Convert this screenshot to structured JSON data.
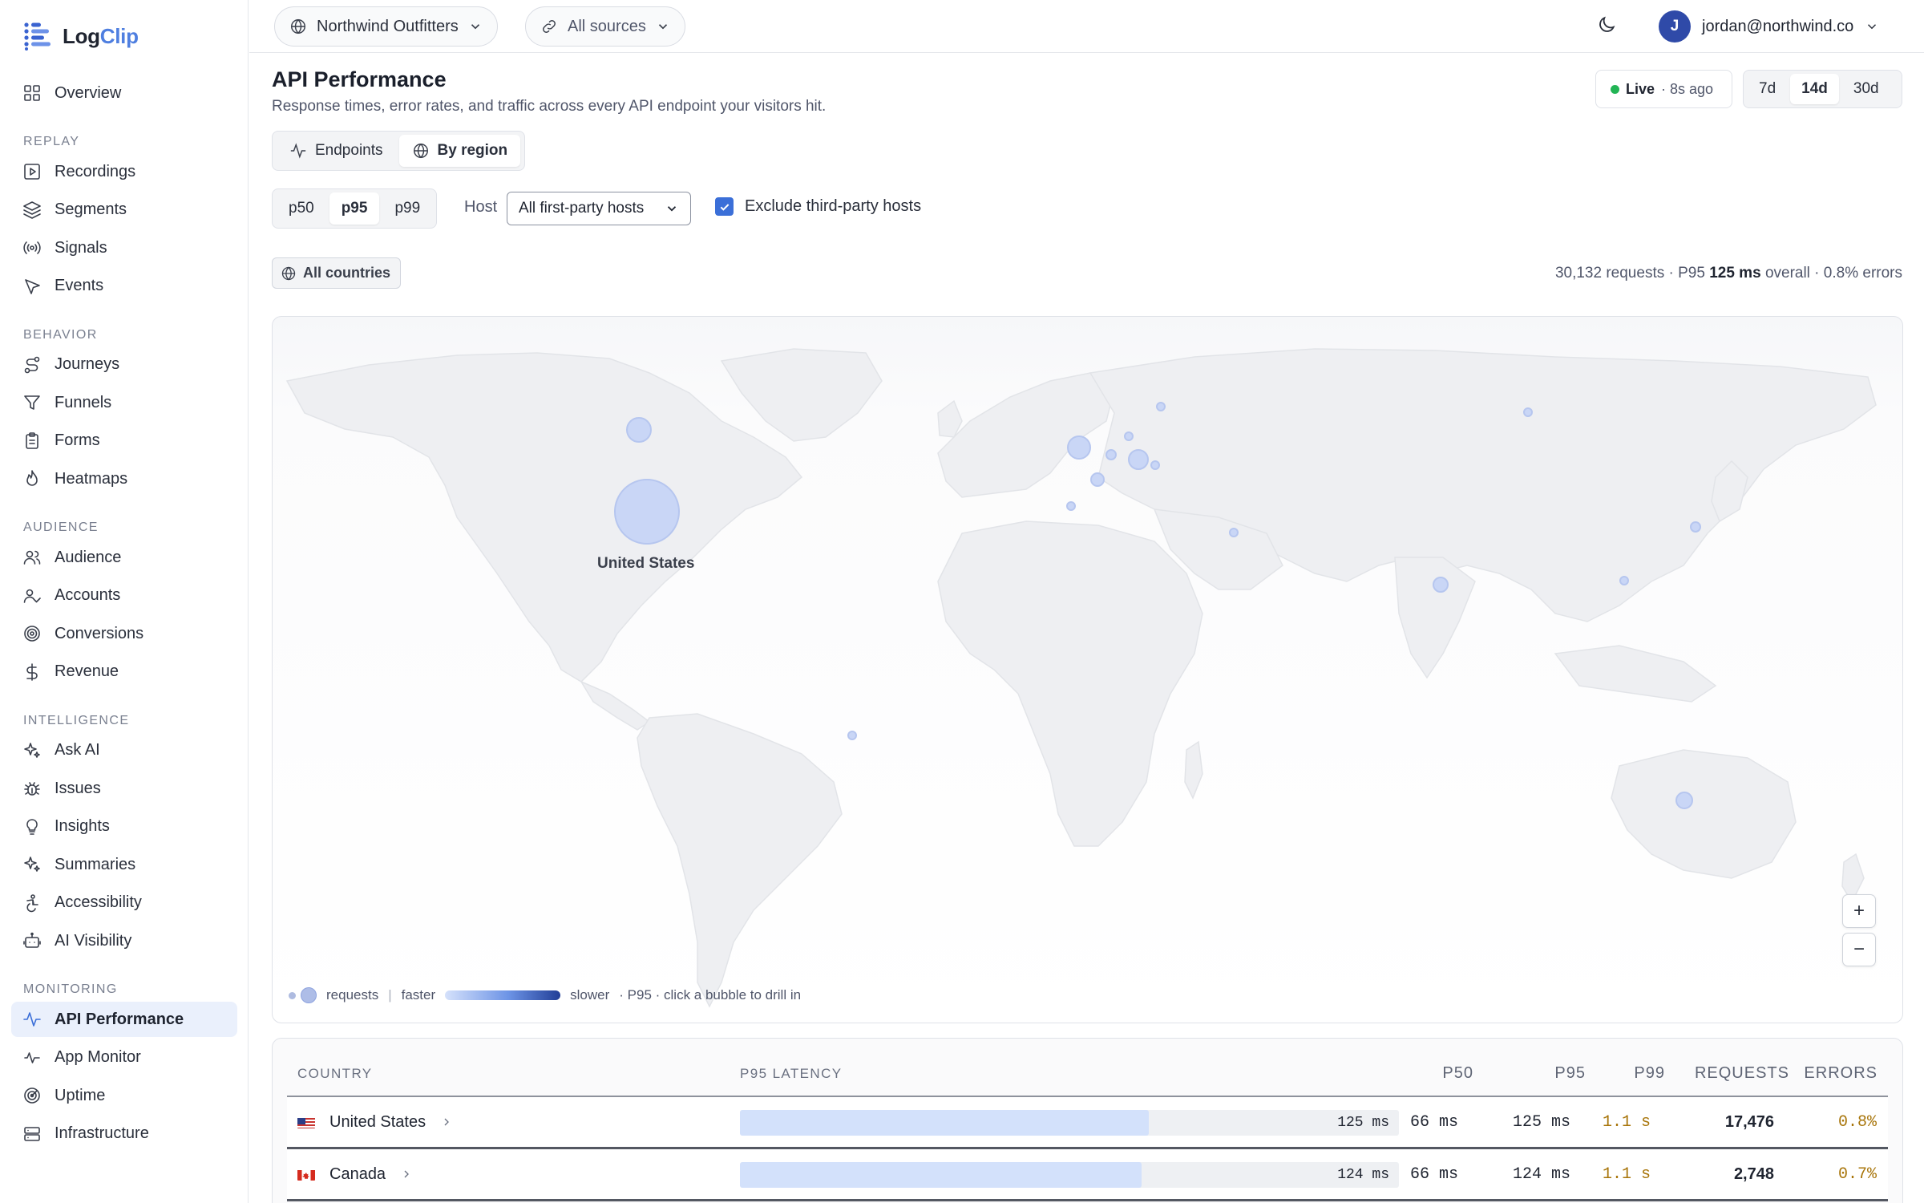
{
  "app": {
    "brand_part1": "Log",
    "brand_part2": "Clip",
    "accent": "#3b6fd8"
  },
  "sidebar": {
    "top_item": {
      "label": "Overview",
      "icon": "grid-icon"
    },
    "sections": [
      {
        "label": "Replay",
        "items": [
          {
            "label": "Recordings",
            "icon": "play-square-icon"
          },
          {
            "label": "Segments",
            "icon": "layers-icon"
          },
          {
            "label": "Signals",
            "icon": "broadcast-icon"
          },
          {
            "label": "Events",
            "icon": "cursor-icon"
          }
        ]
      },
      {
        "label": "Behavior",
        "items": [
          {
            "label": "Journeys",
            "icon": "route-icon"
          },
          {
            "label": "Funnels",
            "icon": "funnel-icon"
          },
          {
            "label": "Forms",
            "icon": "clipboard-icon"
          },
          {
            "label": "Heatmaps",
            "icon": "flame-icon"
          }
        ]
      },
      {
        "label": "Audience",
        "items": [
          {
            "label": "Audience",
            "icon": "users-icon"
          },
          {
            "label": "Accounts",
            "icon": "user-check-icon"
          },
          {
            "label": "Conversions",
            "icon": "target-icon"
          },
          {
            "label": "Revenue",
            "icon": "dollar-icon"
          }
        ]
      },
      {
        "label": "Intelligence",
        "items": [
          {
            "label": "Ask AI",
            "icon": "sparkles-icon"
          },
          {
            "label": "Issues",
            "icon": "bug-icon"
          },
          {
            "label": "Insights",
            "icon": "lightbulb-icon"
          },
          {
            "label": "Summaries",
            "icon": "sparkles-icon"
          },
          {
            "label": "Accessibility",
            "icon": "accessibility-icon"
          },
          {
            "label": "AI Visibility",
            "icon": "bot-icon"
          }
        ]
      },
      {
        "label": "Monitoring",
        "items": [
          {
            "label": "API Performance",
            "icon": "activity-icon",
            "active": true
          },
          {
            "label": "App Monitor",
            "icon": "monitor-icon"
          },
          {
            "label": "Uptime",
            "icon": "radar-icon"
          },
          {
            "label": "Infrastructure",
            "icon": "server-icon"
          }
        ]
      }
    ]
  },
  "topbar": {
    "workspace": "Northwind Outfitters",
    "sources": "All sources",
    "user_initial": "J",
    "user_email": "jordan@northwind.co"
  },
  "header": {
    "title": "API Performance",
    "subtitle": "Response times, error rates, and traffic across every API endpoint your visitors hit.",
    "live_label": "Live",
    "live_age": "· 8s ago",
    "ranges": [
      "7d",
      "14d",
      "30d"
    ],
    "range_selected": "14d"
  },
  "view_tabs": [
    {
      "label": "Endpoints",
      "icon": "activity-icon"
    },
    {
      "label": "By region",
      "icon": "globe-icon",
      "selected": true
    }
  ],
  "filters": {
    "percentiles": [
      "p50",
      "p95",
      "p99"
    ],
    "percentile_selected": "p95",
    "host_label": "Host",
    "host_value": "All first-party hosts",
    "exclude_label": "Exclude third-party hosts",
    "exclude_checked": true,
    "country_chip": "All countries"
  },
  "summary": {
    "requests": "30,132 requests · P95",
    "overall_value": "125 ms",
    "overall_suffix": "overall · 0.8% errors"
  },
  "map": {
    "highlight_label": "United States",
    "zoom_in": "+",
    "zoom_out": "−",
    "legend": {
      "requests": "requests",
      "sep": "|",
      "faster": "faster",
      "slower": "slower",
      "note": "· P95 · click a bubble to drill in"
    },
    "bubble_color": "#c9d6f6",
    "bubble_stroke": "#b6c6ef"
  },
  "table": {
    "headers": {
      "country": "Country",
      "latency": "P95 Latency",
      "p50": "P50",
      "p95": "P95",
      "p99": "P99",
      "requests": "Requests",
      "errors": "Errors"
    },
    "rows": [
      {
        "country": "United States",
        "flag": "us-flag-icon",
        "latency": "125 ms",
        "latency_fraction": 0.62,
        "p50": "66 ms",
        "p95": "125 ms",
        "p99": "1.1 s",
        "requests": "17,476",
        "errors": "0.8%"
      },
      {
        "country": "Canada",
        "flag": "ca-flag-icon",
        "latency": "124 ms",
        "latency_fraction": 0.61,
        "p50": "66 ms",
        "p95": "124 ms",
        "p99": "1.1 s",
        "requests": "2,748",
        "errors": "0.7%"
      }
    ]
  }
}
